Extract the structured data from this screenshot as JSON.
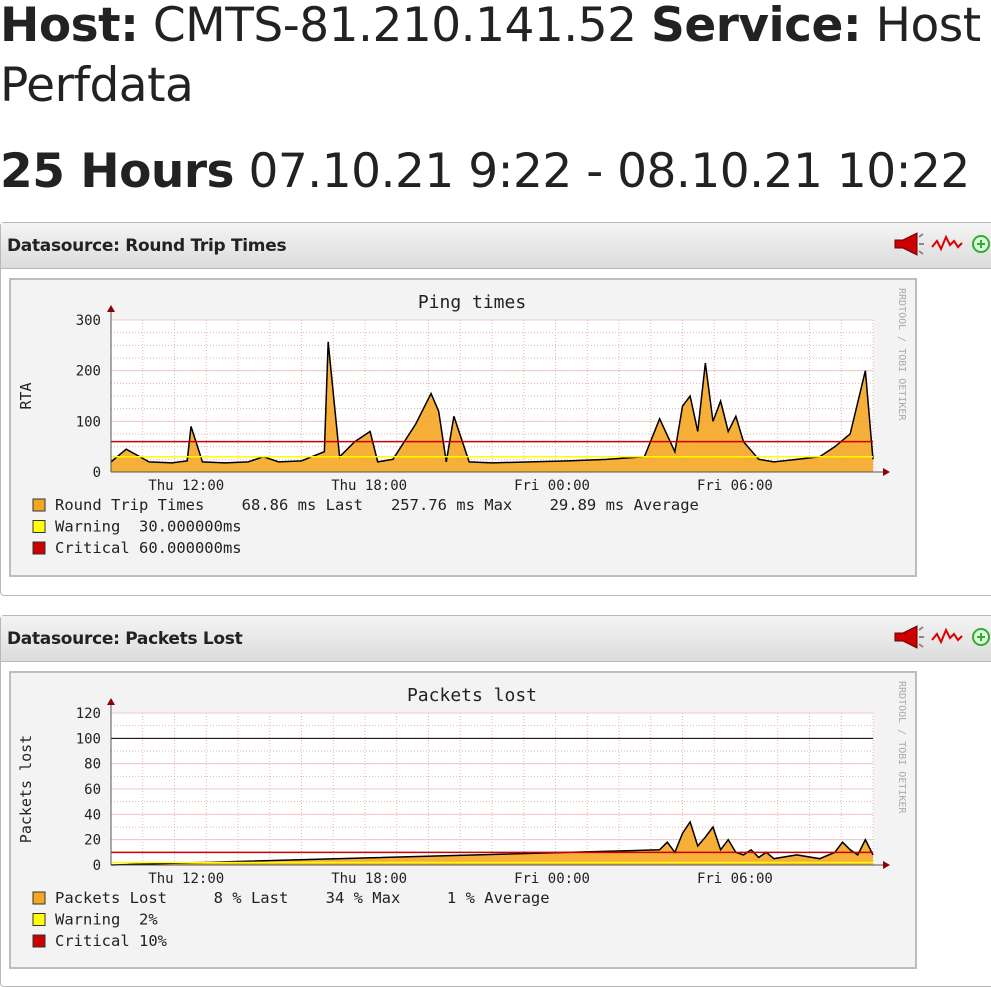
{
  "header": {
    "host_label": "Host:",
    "host_value": "CMTS-81.210.141.52",
    "service_label": "Service:",
    "service_value": "Host Perfdata",
    "range_label": "25 Hours",
    "range_value": "07.10.21 9:22 - 08.10.21 10:22"
  },
  "colors": {
    "area_fill": "#f5a623",
    "warning": "#ffff00",
    "critical": "#cc0000",
    "line": "#000000",
    "grid": "#e8b0b0"
  },
  "panels": [
    {
      "title": "Datasource: Round Trip Times",
      "icons": [
        "megaphone-icon",
        "graph-icon",
        "zoom-icon"
      ]
    },
    {
      "title": "Datasource: Packets Lost",
      "icons": [
        "megaphone-icon",
        "graph-icon",
        "zoom-icon"
      ]
    }
  ],
  "watermark": "RRDTOOL / TOBI OETIKER",
  "chart_data": [
    {
      "type": "area",
      "title": "Ping times",
      "ylabel": "RTA",
      "ylim": [
        0,
        300
      ],
      "yticks": [
        0,
        100,
        200,
        300
      ],
      "xticks": [
        "Thu 12:00",
        "Thu 18:00",
        "Fri 00:00",
        "Fri 06:00"
      ],
      "grid": true,
      "thresholds": {
        "warning": 30,
        "critical": 60
      },
      "legend": [
        {
          "name": "Round Trip Times",
          "text": "Round Trip Times    68.86 ms Last   257.76 ms Max    29.89 ms Average"
        },
        {
          "name": "Warning",
          "text": "Warning  30.000000ms"
        },
        {
          "name": "Critical",
          "text": "Critical 60.000000ms"
        }
      ],
      "x": [
        0.0,
        0.02,
        0.05,
        0.08,
        0.1,
        0.105,
        0.12,
        0.15,
        0.18,
        0.2,
        0.22,
        0.25,
        0.28,
        0.285,
        0.3,
        0.32,
        0.34,
        0.35,
        0.37,
        0.4,
        0.42,
        0.43,
        0.44,
        0.45,
        0.47,
        0.5,
        0.55,
        0.6,
        0.65,
        0.7,
        0.72,
        0.74,
        0.75,
        0.76,
        0.77,
        0.78,
        0.79,
        0.8,
        0.81,
        0.82,
        0.83,
        0.85,
        0.87,
        0.9,
        0.93,
        0.95,
        0.97,
        0.99,
        1.0
      ],
      "values": [
        20,
        45,
        20,
        18,
        22,
        90,
        20,
        18,
        20,
        30,
        20,
        22,
        40,
        257,
        30,
        60,
        80,
        20,
        25,
        95,
        155,
        120,
        20,
        110,
        20,
        18,
        20,
        22,
        25,
        30,
        105,
        40,
        130,
        150,
        80,
        215,
        100,
        140,
        80,
        110,
        60,
        25,
        20,
        25,
        30,
        50,
        75,
        200,
        25
      ]
    },
    {
      "type": "area",
      "title": "Packets lost",
      "ylabel": "Packets lost",
      "ylim": [
        0,
        120
      ],
      "yticks": [
        0,
        20,
        40,
        60,
        80,
        100,
        120
      ],
      "xticks": [
        "Thu 12:00",
        "Thu 18:00",
        "Fri 00:00",
        "Fri 06:00"
      ],
      "grid": true,
      "thresholds": {
        "warning": 2,
        "critical": 10,
        "max": 100
      },
      "legend": [
        {
          "name": "Packets Lost",
          "text": "Packets Lost     8 % Last    34 % Max     1 % Average"
        },
        {
          "name": "Warning",
          "text": "Warning  2%"
        },
        {
          "name": "Critical",
          "text": "Critical 10%"
        }
      ],
      "x": [
        0.0,
        0.72,
        0.73,
        0.74,
        0.75,
        0.76,
        0.77,
        0.78,
        0.79,
        0.8,
        0.81,
        0.82,
        0.83,
        0.84,
        0.85,
        0.86,
        0.87,
        0.9,
        0.93,
        0.95,
        0.96,
        0.97,
        0.98,
        0.99,
        1.0
      ],
      "values": [
        0,
        12,
        18,
        10,
        25,
        34,
        15,
        22,
        30,
        12,
        20,
        10,
        8,
        12,
        6,
        10,
        5,
        8,
        5,
        10,
        18,
        12,
        8,
        20,
        8
      ]
    }
  ]
}
